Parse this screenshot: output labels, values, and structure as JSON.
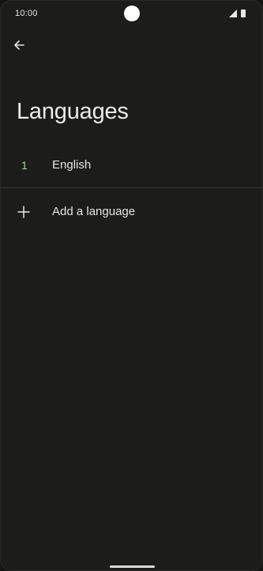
{
  "status_bar": {
    "time": "10:00"
  },
  "header": {
    "title": "Languages"
  },
  "languages": [
    {
      "index": "1",
      "name": "English"
    }
  ],
  "actions": {
    "add_language_label": "Add a language"
  },
  "colors": {
    "background": "#1c1d1a",
    "text": "#e6e6e3",
    "accent": "#a7d2a0",
    "divider": "#3a3b38"
  },
  "icons": {
    "back": "arrow-back-icon",
    "add": "plus-icon",
    "signal": "signal-icon",
    "battery": "battery-icon"
  }
}
